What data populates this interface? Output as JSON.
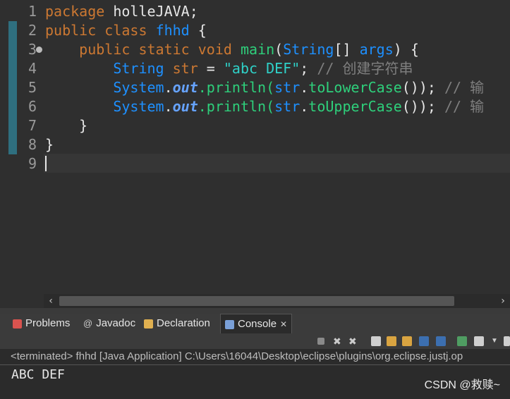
{
  "editor": {
    "line_numbers": [
      "1",
      "2",
      "3",
      "4",
      "5",
      "6",
      "7",
      "8",
      "9"
    ],
    "lines": [
      {
        "tokens": [
          {
            "t": "package",
            "c": "kw"
          },
          {
            "t": " holleJAVA;",
            "c": "cls"
          }
        ]
      },
      {
        "tokens": [
          {
            "t": "public",
            "c": "kw"
          },
          {
            "t": " ",
            "c": "cls"
          },
          {
            "t": "class",
            "c": "kw"
          },
          {
            "t": " ",
            "c": "cls"
          },
          {
            "t": "fhhd",
            "c": "type"
          },
          {
            "t": " {",
            "c": "cls"
          }
        ]
      },
      {
        "tokens": [
          {
            "t": "    ",
            "c": "cls"
          },
          {
            "t": "public",
            "c": "kw"
          },
          {
            "t": " ",
            "c": "cls"
          },
          {
            "t": "static",
            "c": "kw"
          },
          {
            "t": " ",
            "c": "cls"
          },
          {
            "t": "void",
            "c": "kw"
          },
          {
            "t": " ",
            "c": "cls"
          },
          {
            "t": "main",
            "c": "method2"
          },
          {
            "t": "(",
            "c": "cls"
          },
          {
            "t": "String",
            "c": "type"
          },
          {
            "t": "[] ",
            "c": "cls"
          },
          {
            "t": "args",
            "c": "type"
          },
          {
            "t": ") {",
            "c": "cls"
          }
        ]
      },
      {
        "tokens": [
          {
            "t": "        ",
            "c": "cls"
          },
          {
            "t": "String",
            "c": "type"
          },
          {
            "t": " ",
            "c": "cls"
          },
          {
            "t": "str",
            "c": "kw"
          },
          {
            "t": " = ",
            "c": "cls"
          },
          {
            "t": "\"abc DEF\"",
            "c": "str"
          },
          {
            "t": "; ",
            "c": "cls"
          },
          {
            "t": "// 创建字符串",
            "c": "cmt"
          }
        ]
      },
      {
        "tokens": [
          {
            "t": "        ",
            "c": "cls"
          },
          {
            "t": "System",
            "c": "type"
          },
          {
            "t": ".",
            "c": "cls"
          },
          {
            "t": "out",
            "c": "fieldi"
          },
          {
            "t": ".println(",
            "c": "method2"
          },
          {
            "t": "str",
            "c": "type"
          },
          {
            "t": ".",
            "c": "cls"
          },
          {
            "t": "toLowerCase",
            "c": "method2"
          },
          {
            "t": "()); ",
            "c": "cls"
          },
          {
            "t": "// 输",
            "c": "cmt"
          }
        ]
      },
      {
        "tokens": [
          {
            "t": "        ",
            "c": "cls"
          },
          {
            "t": "System",
            "c": "type"
          },
          {
            "t": ".",
            "c": "cls"
          },
          {
            "t": "out",
            "c": "fieldi"
          },
          {
            "t": ".println(",
            "c": "method2"
          },
          {
            "t": "str",
            "c": "type"
          },
          {
            "t": ".",
            "c": "cls"
          },
          {
            "t": "toUpperCase",
            "c": "method2"
          },
          {
            "t": "()); ",
            "c": "cls"
          },
          {
            "t": "// 输",
            "c": "cmt"
          }
        ]
      },
      {
        "tokens": [
          {
            "t": "    }",
            "c": "cls"
          }
        ]
      },
      {
        "tokens": [
          {
            "t": "}",
            "c": "cls"
          }
        ]
      },
      {
        "tokens": [
          {
            "t": "",
            "c": "cls"
          }
        ]
      }
    ]
  },
  "tabs": [
    {
      "label": "Problems",
      "icon": "problems-icon",
      "color": "#d9534f",
      "active": false
    },
    {
      "label": "Javadoc",
      "icon": "javadoc-icon",
      "color": "#cccccc",
      "active": false
    },
    {
      "label": "Declaration",
      "icon": "declaration-icon",
      "color": "#e0b050",
      "active": false
    },
    {
      "label": "Console",
      "icon": "console-icon",
      "color": "#7aa0d8",
      "active": true
    }
  ],
  "console_tab_close": "✕",
  "console": {
    "header": "<terminated> fhhd [Java Application] C:\\Users\\16044\\Desktop\\eclipse\\plugins\\org.eclipse.justj.op",
    "output": "ABC DEF"
  },
  "watermark": "CSDN @救赎~",
  "scroll": {
    "left_arrow": "‹",
    "right_arrow": "›"
  },
  "colors": {
    "background": "#2f2f2f",
    "keyword": "#cc7832",
    "type": "#1e90ff",
    "string": "#2fd1c8",
    "comment": "#7f7f7f"
  }
}
